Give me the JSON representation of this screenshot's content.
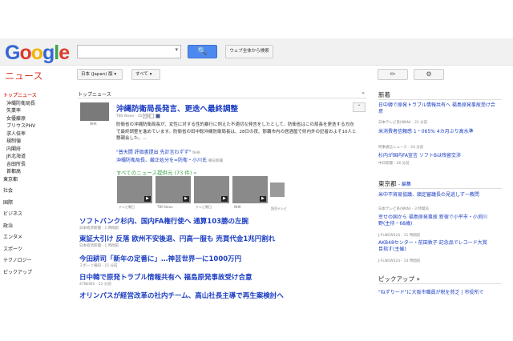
{
  "app": {
    "logo": "Google",
    "section": "ニュース"
  },
  "search": {
    "value": "",
    "search_icon": "🔍",
    "web_button": "ウェブ全体から検索"
  },
  "filters": {
    "edition": "日本 (Japan) 版",
    "edition_arrow": "▾",
    "filter": "すべて",
    "filter_arrow": "▾"
  },
  "toolbar": {
    "edit_icon": "✏",
    "gear_icon": "⚙"
  },
  "sidebar": {
    "items": [
      "トップニュース",
      "沖縄防衛局長",
      "失業率",
      "女優藤原",
      "プリウスPHV",
      "求人倍率",
      "規制値",
      "内閣府",
      "JR北海道",
      "吉田所長",
      "首都高",
      "東京都",
      "社会",
      "国際",
      "ビジネス",
      "政治",
      "エンタメ",
      "スポーツ",
      "テクノロジー",
      "ピックアップ"
    ]
  },
  "main": {
    "section_title": "トップニュース",
    "section_arrow": "»",
    "collapse_icon": "⌃",
    "lead": {
      "title": "沖縄防衛局長発言、更迭へ最終調整",
      "source": "TBS News - 35 分前",
      "thumb_label": "NHK",
      "body": "防衛省の沖縄防衛局長が、女性に対する性的暴行に例えた不適切な発言をしたとして、防衛省はこの局長を更迭する方向で最終調整を進めています。防衛省の田中聡沖縄防衛局長は、28日の夜、那覇市内の居酒屋で県内外の記者およそ10人と懇親会した。...",
      "related": [
        {
          "text": "\"普天間 評価書提出 先計言わずず\"",
          "src": "NHK"
        },
        {
          "text": "沖縄防衛局長、厳正処分を=防衛・小川氏",
          "src": "朝日新聞"
        }
      ],
      "all_news": "すべてのニュース提供元 (73 件) »",
      "images": [
        {
          "cap": "テレビ朝日"
        },
        {
          "cap": "TBS News"
        },
        {
          "cap": "テレビ朝日"
        },
        {
          "cap": "NHK"
        }
      ],
      "more_cap": "読売テレビ"
    },
    "stories": [
      {
        "title": "ソフトバンク杉内、国内FA権行使へ 通算103勝の左腕",
        "src": "日本経済新聞 - 1 時間前"
      },
      {
        "title": "東証大引け 反落 欧州不安後退、円高一服も 売買代金1兆円割れ",
        "src": "日本経済新聞 - 1 時間前"
      },
      {
        "title": "今田耕司「新年の定番に」…神芸世界一に1000万円",
        "src": "スポーツ報知 - 15 分前"
      },
      {
        "title": "日中韓で原発トラブル情報共有へ 福島原発事故受け合意",
        "src": "47NEWS - 22 分前"
      },
      {
        "title": "オリンパスが経営改革の社内チーム、高山社長主導で再生案検討へ",
        "src": ""
      }
    ]
  },
  "right": {
    "newest_title": "新着",
    "newest": [
      {
        "title": "日中韓で原発トラブル情報共有へ 福島原発事故受け合意",
        "src": "日本テレビ系(NNN) - 21 分前"
      },
      {
        "title": "米消費者信頼感 1・065% 4カ月ぶり高水準",
        "src": "時事通信ニュース - 24 分前"
      },
      {
        "title": "杉内が国内FA宣言 ソフトBは残留交渉",
        "src": "中日新聞 - 26 分前"
      }
    ],
    "tokyo_title": "東京都",
    "tokyo_edit": "- 編集",
    "tokyo": [
      {
        "title": "米中不貿易協議、鎮定審議長の見逃しず一教問",
        "src": "日本テレビ系(NNN) - 3 時間前"
      },
      {
        "title": "幸せの国から 福島原発事故 新宿で小平市・小渕川野(主待・68歳)",
        "src": "J-FLNEWS24 - 11 時間前"
      },
      {
        "title": "AKB48センター・前田敦子 記念品でレコード大賞目指す(主催)",
        "src": "J-FLNEWS24 - 14 時間前"
      }
    ],
    "pickup_title": "ピックアップ »",
    "pickup": [
      {
        "title": "\"ねずりード\"に大阪市職員が税を貧乏 | 市役所で",
        "src": ""
      }
    ]
  }
}
